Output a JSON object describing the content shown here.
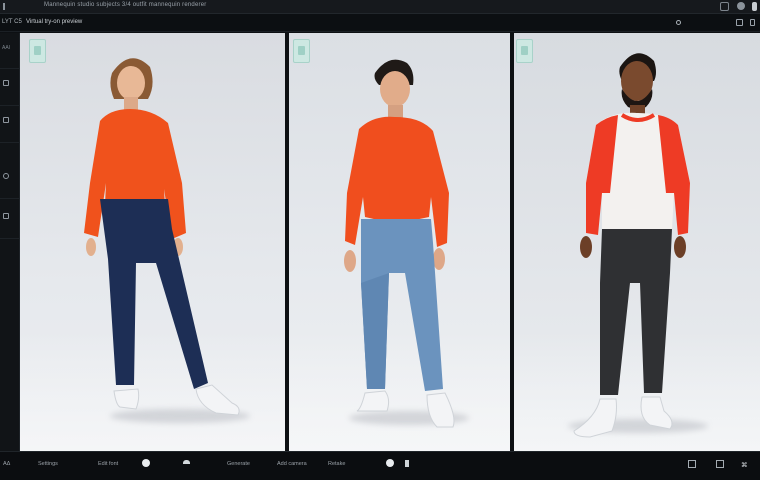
{
  "window": {
    "title": "Mannequin studio  subjects  3/4  outfit  mannequin  renderer"
  },
  "header": {
    "left_label": "LYT C5",
    "app_title": "Virtual try-on preview",
    "status_text": ""
  },
  "sidebar": {
    "items": [
      {
        "label": "AAI"
      },
      {
        "label": ""
      },
      {
        "label": ""
      },
      {
        "label": ""
      },
      {
        "label": ""
      }
    ]
  },
  "panels": [
    {
      "subject": "woman",
      "top": "orange sweater",
      "bottom": "navy trousers",
      "shoes": "white sneakers",
      "top_color": "#f0521c",
      "bottom_color": "#1d2e55"
    },
    {
      "subject": "man",
      "top": "orange sweater",
      "bottom": "light blue jeans",
      "shoes": "white sneakers",
      "top_color": "#f04e1e",
      "bottom_color": "#6b93be"
    },
    {
      "subject": "bearded man",
      "top": "red and white raglan sweatshirt",
      "bottom": "charcoal trousers",
      "shoes": "white sneakers",
      "top_color": "#ee3b25",
      "bottom_color": "#2f3033"
    }
  ],
  "bottombar": {
    "left_label": "ΑΔ",
    "items": [
      "Settings",
      "Edit font",
      "",
      "",
      "Generate",
      "Add camera",
      "Retake",
      "",
      ""
    ]
  }
}
